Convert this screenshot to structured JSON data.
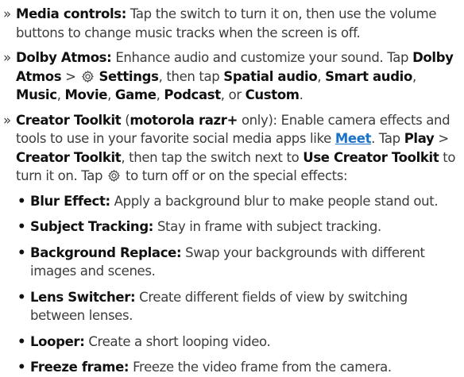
{
  "bullets": {
    "section": "»",
    "sub": "•"
  },
  "media": {
    "title": "Media controls:",
    "text": "Tap the switch to turn it on, then use the volume buttons to change music tracks when the screen is off."
  },
  "dolby": {
    "title": "Dolby Atmos:",
    "t1": "Enhance audio and customize your sound. Tap",
    "b_dolby": "Dolby Atmos",
    "sep": ">",
    "gear_icon": "gear-icon",
    "b_settings": "Settings",
    "t2": ", then tap",
    "b_spatial": "Spatial audio",
    "b_smart": "Smart audio",
    "b_music": "Music",
    "b_movie": "Movie",
    "b_game": "Game",
    "b_podcast": "Podcast",
    "t_or": ", or",
    "b_custom": "Custom",
    "end": "."
  },
  "creator": {
    "title": "Creator Toolkit",
    "paren_open": "(",
    "b_model": "motorola razr+",
    "t1": " only): Enable camera effects and tools to use in your favorite social media apps like ",
    "link_meet": "Meet",
    "t2": ". Tap ",
    "b_play": "Play",
    "sep": " >",
    "b_toolkit": "Creator Toolkit",
    "t3": ", then tap the switch next to ",
    "b_use": "Use Creator Toolkit",
    "t4": " to turn it on. Tap",
    "gear_icon": "gear-icon",
    "t5": "to turn off or on the special effects:"
  },
  "effects": [
    {
      "title": "Blur Effect:",
      "text": "Apply a background blur to make people stand out."
    },
    {
      "title": "Subject Tracking:",
      "text": "Stay in frame with subject tracking."
    },
    {
      "title": "Background Replace:",
      "text": "Swap your backgrounds with different images and scenes."
    },
    {
      "title": "Lens Switcher:",
      "text": "Create different fields of view by switching between lenses."
    },
    {
      "title": "Looper:",
      "text": "Create a short looping video."
    },
    {
      "title": "Freeze frame:",
      "text": "Freeze the video frame from the camera."
    }
  ],
  "colors": {
    "text": "#3c3c3c",
    "bold": "#111111",
    "link": "#1a73c8"
  }
}
